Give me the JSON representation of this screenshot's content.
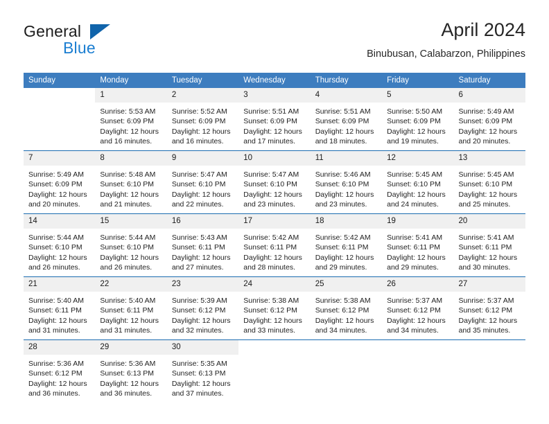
{
  "brand": {
    "name_part1": "General",
    "name_part2": "Blue"
  },
  "header": {
    "title": "April 2024",
    "subtitle": "Binubusan, Calabarzon, Philippines"
  },
  "colors": {
    "header_bar": "#3d7dbf",
    "row_divider": "#1a6bb0",
    "daynum_band": "#f0f0f0",
    "brand_blue": "#1b7ed1",
    "logo_triangle": "#1064ab"
  },
  "weekday_headers": [
    "Sunday",
    "Monday",
    "Tuesday",
    "Wednesday",
    "Thursday",
    "Friday",
    "Saturday"
  ],
  "weeks": [
    [
      {
        "day": ""
      },
      {
        "day": "1",
        "sunrise": "Sunrise: 5:53 AM",
        "sunset": "Sunset: 6:09 PM",
        "daylight1": "Daylight: 12 hours",
        "daylight2": "and 16 minutes."
      },
      {
        "day": "2",
        "sunrise": "Sunrise: 5:52 AM",
        "sunset": "Sunset: 6:09 PM",
        "daylight1": "Daylight: 12 hours",
        "daylight2": "and 16 minutes."
      },
      {
        "day": "3",
        "sunrise": "Sunrise: 5:51 AM",
        "sunset": "Sunset: 6:09 PM",
        "daylight1": "Daylight: 12 hours",
        "daylight2": "and 17 minutes."
      },
      {
        "day": "4",
        "sunrise": "Sunrise: 5:51 AM",
        "sunset": "Sunset: 6:09 PM",
        "daylight1": "Daylight: 12 hours",
        "daylight2": "and 18 minutes."
      },
      {
        "day": "5",
        "sunrise": "Sunrise: 5:50 AM",
        "sunset": "Sunset: 6:09 PM",
        "daylight1": "Daylight: 12 hours",
        "daylight2": "and 19 minutes."
      },
      {
        "day": "6",
        "sunrise": "Sunrise: 5:49 AM",
        "sunset": "Sunset: 6:09 PM",
        "daylight1": "Daylight: 12 hours",
        "daylight2": "and 20 minutes."
      }
    ],
    [
      {
        "day": "7",
        "sunrise": "Sunrise: 5:49 AM",
        "sunset": "Sunset: 6:09 PM",
        "daylight1": "Daylight: 12 hours",
        "daylight2": "and 20 minutes."
      },
      {
        "day": "8",
        "sunrise": "Sunrise: 5:48 AM",
        "sunset": "Sunset: 6:10 PM",
        "daylight1": "Daylight: 12 hours",
        "daylight2": "and 21 minutes."
      },
      {
        "day": "9",
        "sunrise": "Sunrise: 5:47 AM",
        "sunset": "Sunset: 6:10 PM",
        "daylight1": "Daylight: 12 hours",
        "daylight2": "and 22 minutes."
      },
      {
        "day": "10",
        "sunrise": "Sunrise: 5:47 AM",
        "sunset": "Sunset: 6:10 PM",
        "daylight1": "Daylight: 12 hours",
        "daylight2": "and 23 minutes."
      },
      {
        "day": "11",
        "sunrise": "Sunrise: 5:46 AM",
        "sunset": "Sunset: 6:10 PM",
        "daylight1": "Daylight: 12 hours",
        "daylight2": "and 23 minutes."
      },
      {
        "day": "12",
        "sunrise": "Sunrise: 5:45 AM",
        "sunset": "Sunset: 6:10 PM",
        "daylight1": "Daylight: 12 hours",
        "daylight2": "and 24 minutes."
      },
      {
        "day": "13",
        "sunrise": "Sunrise: 5:45 AM",
        "sunset": "Sunset: 6:10 PM",
        "daylight1": "Daylight: 12 hours",
        "daylight2": "and 25 minutes."
      }
    ],
    [
      {
        "day": "14",
        "sunrise": "Sunrise: 5:44 AM",
        "sunset": "Sunset: 6:10 PM",
        "daylight1": "Daylight: 12 hours",
        "daylight2": "and 26 minutes."
      },
      {
        "day": "15",
        "sunrise": "Sunrise: 5:44 AM",
        "sunset": "Sunset: 6:10 PM",
        "daylight1": "Daylight: 12 hours",
        "daylight2": "and 26 minutes."
      },
      {
        "day": "16",
        "sunrise": "Sunrise: 5:43 AM",
        "sunset": "Sunset: 6:11 PM",
        "daylight1": "Daylight: 12 hours",
        "daylight2": "and 27 minutes."
      },
      {
        "day": "17",
        "sunrise": "Sunrise: 5:42 AM",
        "sunset": "Sunset: 6:11 PM",
        "daylight1": "Daylight: 12 hours",
        "daylight2": "and 28 minutes."
      },
      {
        "day": "18",
        "sunrise": "Sunrise: 5:42 AM",
        "sunset": "Sunset: 6:11 PM",
        "daylight1": "Daylight: 12 hours",
        "daylight2": "and 29 minutes."
      },
      {
        "day": "19",
        "sunrise": "Sunrise: 5:41 AM",
        "sunset": "Sunset: 6:11 PM",
        "daylight1": "Daylight: 12 hours",
        "daylight2": "and 29 minutes."
      },
      {
        "day": "20",
        "sunrise": "Sunrise: 5:41 AM",
        "sunset": "Sunset: 6:11 PM",
        "daylight1": "Daylight: 12 hours",
        "daylight2": "and 30 minutes."
      }
    ],
    [
      {
        "day": "21",
        "sunrise": "Sunrise: 5:40 AM",
        "sunset": "Sunset: 6:11 PM",
        "daylight1": "Daylight: 12 hours",
        "daylight2": "and 31 minutes."
      },
      {
        "day": "22",
        "sunrise": "Sunrise: 5:40 AM",
        "sunset": "Sunset: 6:11 PM",
        "daylight1": "Daylight: 12 hours",
        "daylight2": "and 31 minutes."
      },
      {
        "day": "23",
        "sunrise": "Sunrise: 5:39 AM",
        "sunset": "Sunset: 6:12 PM",
        "daylight1": "Daylight: 12 hours",
        "daylight2": "and 32 minutes."
      },
      {
        "day": "24",
        "sunrise": "Sunrise: 5:38 AM",
        "sunset": "Sunset: 6:12 PM",
        "daylight1": "Daylight: 12 hours",
        "daylight2": "and 33 minutes."
      },
      {
        "day": "25",
        "sunrise": "Sunrise: 5:38 AM",
        "sunset": "Sunset: 6:12 PM",
        "daylight1": "Daylight: 12 hours",
        "daylight2": "and 34 minutes."
      },
      {
        "day": "26",
        "sunrise": "Sunrise: 5:37 AM",
        "sunset": "Sunset: 6:12 PM",
        "daylight1": "Daylight: 12 hours",
        "daylight2": "and 34 minutes."
      },
      {
        "day": "27",
        "sunrise": "Sunrise: 5:37 AM",
        "sunset": "Sunset: 6:12 PM",
        "daylight1": "Daylight: 12 hours",
        "daylight2": "and 35 minutes."
      }
    ],
    [
      {
        "day": "28",
        "sunrise": "Sunrise: 5:36 AM",
        "sunset": "Sunset: 6:12 PM",
        "daylight1": "Daylight: 12 hours",
        "daylight2": "and 36 minutes."
      },
      {
        "day": "29",
        "sunrise": "Sunrise: 5:36 AM",
        "sunset": "Sunset: 6:13 PM",
        "daylight1": "Daylight: 12 hours",
        "daylight2": "and 36 minutes."
      },
      {
        "day": "30",
        "sunrise": "Sunrise: 5:35 AM",
        "sunset": "Sunset: 6:13 PM",
        "daylight1": "Daylight: 12 hours",
        "daylight2": "and 37 minutes."
      },
      {
        "day": ""
      },
      {
        "day": ""
      },
      {
        "day": ""
      },
      {
        "day": ""
      }
    ]
  ]
}
